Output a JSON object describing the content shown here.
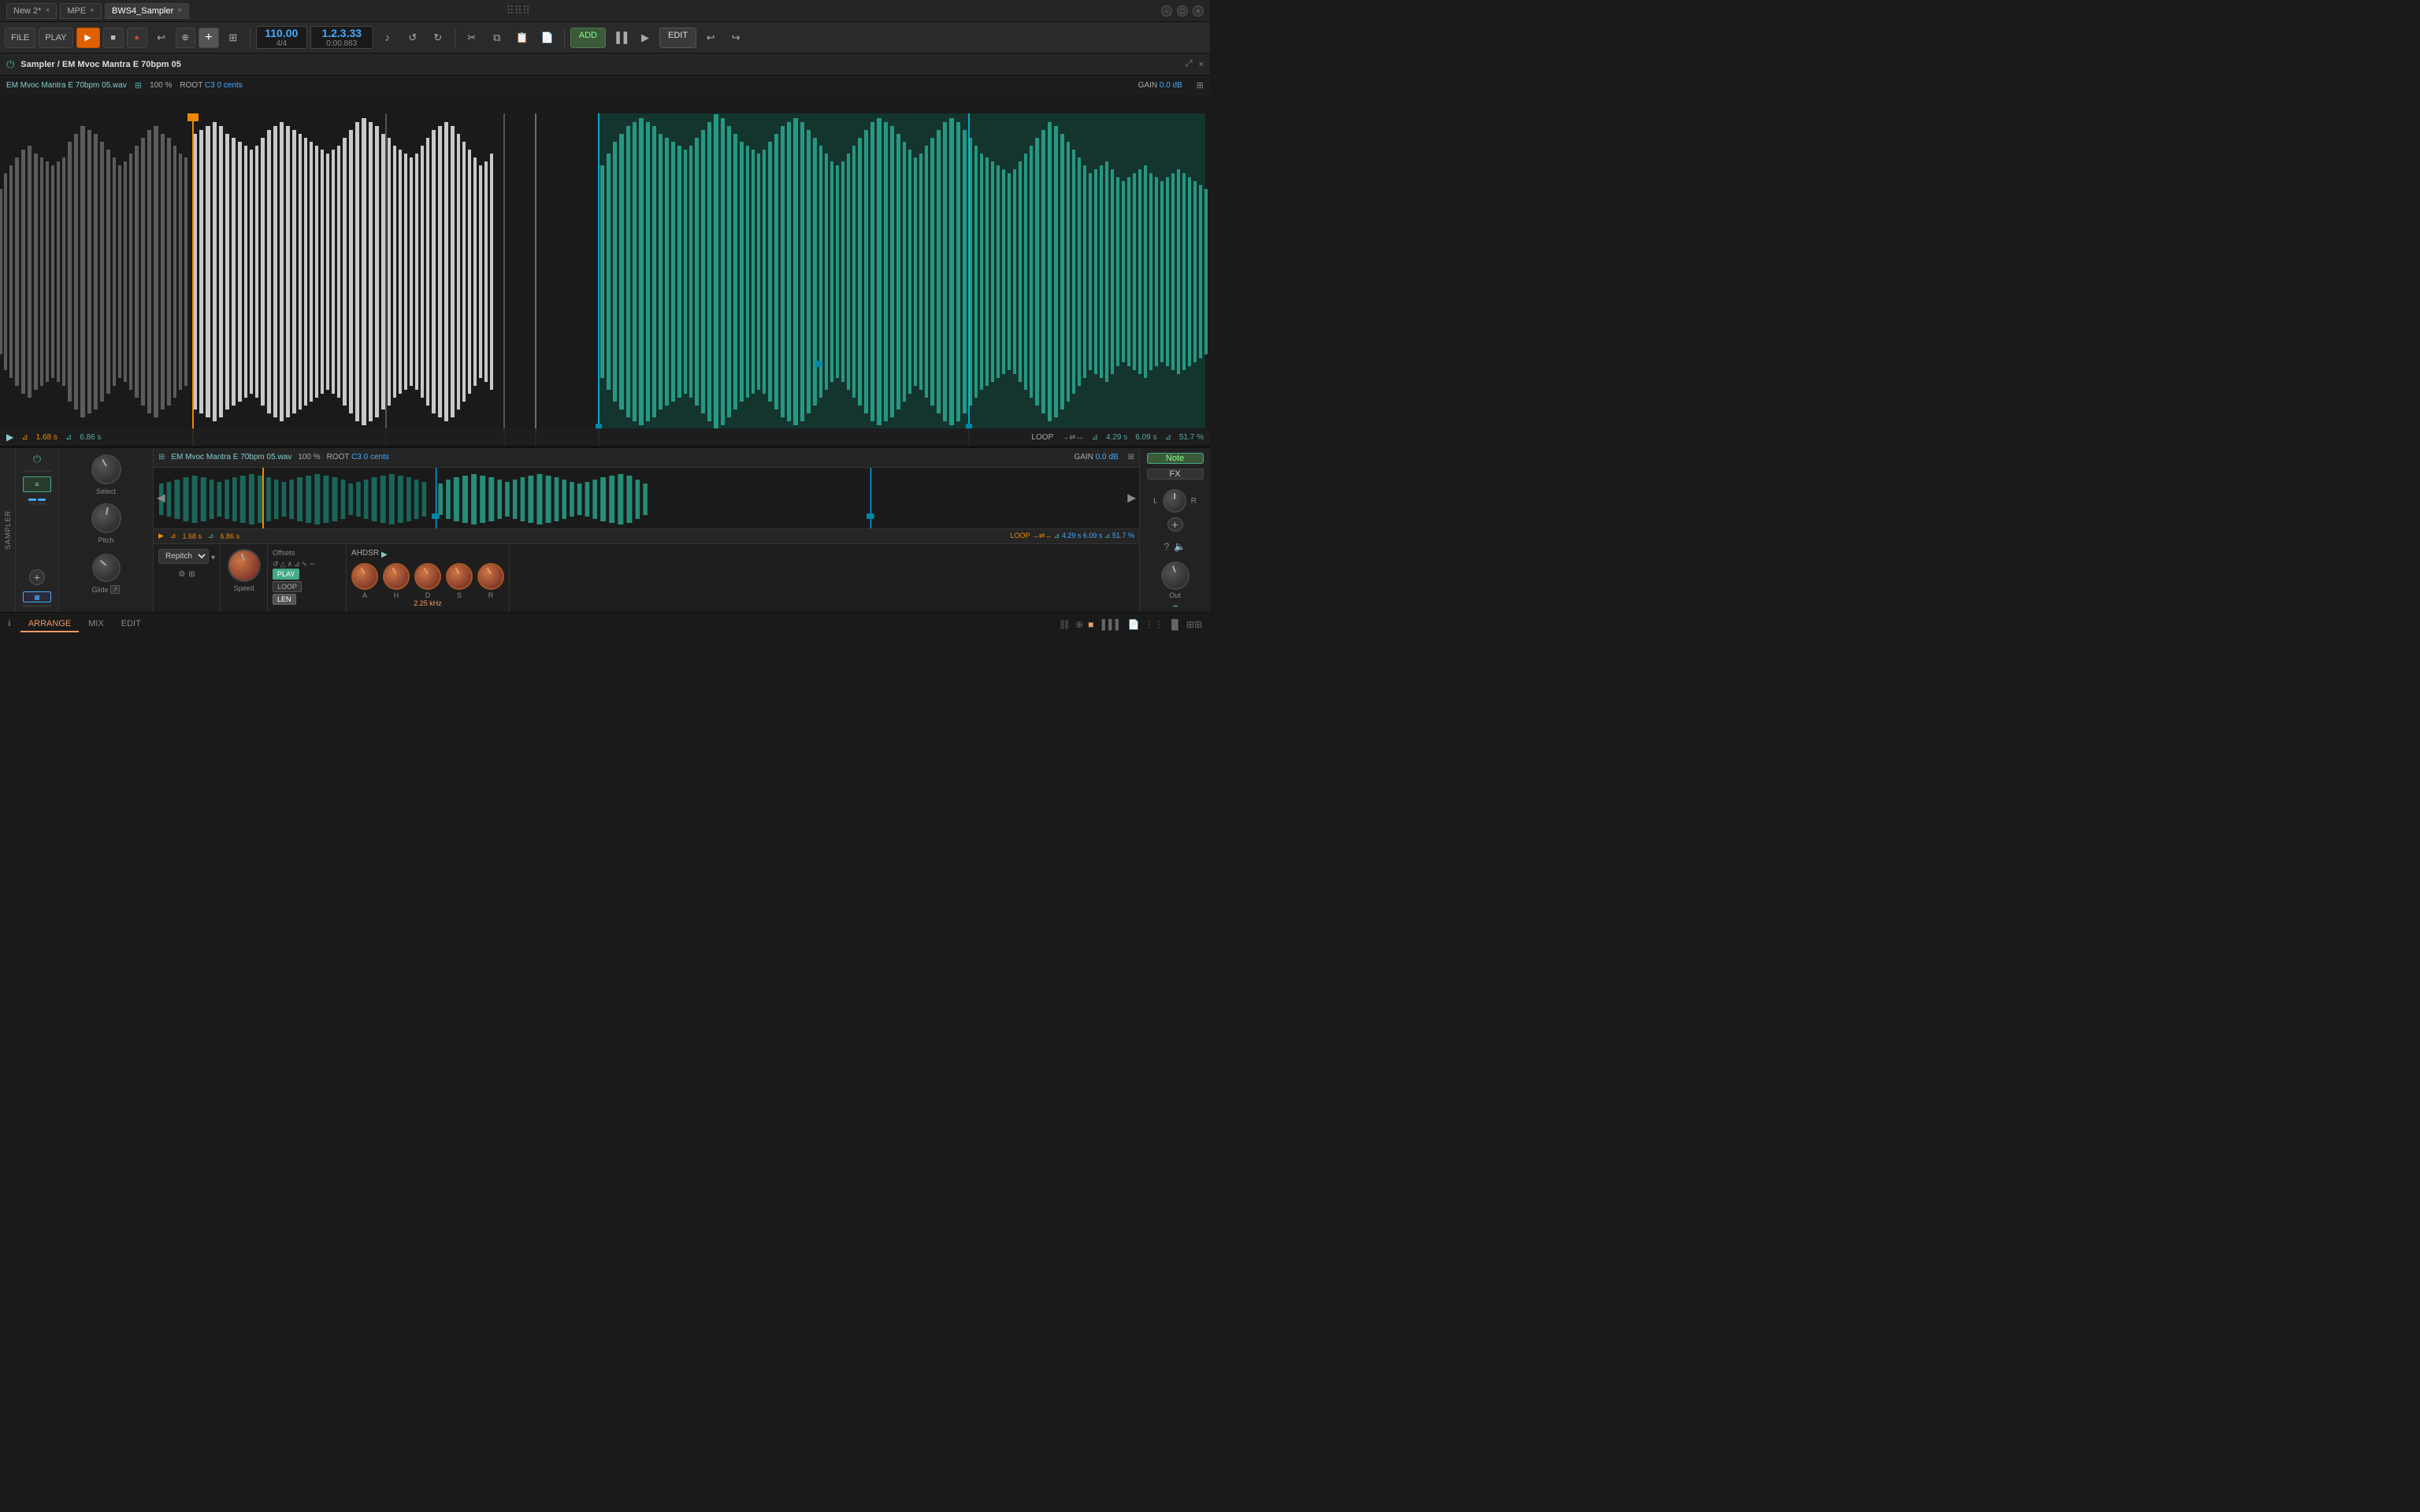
{
  "tabs": [
    {
      "label": "New 2*",
      "active": false,
      "closable": true
    },
    {
      "label": "MPE",
      "active": false,
      "closable": true
    },
    {
      "label": "BWS4_Sampler",
      "active": true,
      "closable": true
    }
  ],
  "toolbar": {
    "file_label": "FILE",
    "play_label": "PLAY",
    "add_label": "+",
    "edit_label": "EDIT",
    "add_track_label": "ADD",
    "tempo": "110.00",
    "time_sig": "4/4",
    "position": "1.2.3.33",
    "time": "0:00.863"
  },
  "sampler": {
    "title": "Sampler / EM Mvoc Mantra E 70bpm 05",
    "filename": "EM Mvoc Mantra E 70bpm 05.wav",
    "zoom": "100 %",
    "root_note": "C3",
    "root_cents": "0 cents",
    "gain": "0.0 dB",
    "play_pos": "1.68 s",
    "length": "6.86 s",
    "loop_start": "4.29 s",
    "loop_end": "6.09 s",
    "loop_pct": "51.7 %"
  },
  "bottom": {
    "note_label": "Note",
    "fx_label": "FX",
    "out_label": "Out",
    "repitch_label": "Repitch",
    "speed_label": "Speed",
    "offsets_label": "Offsets",
    "play_label": "PLAY",
    "loop_label": "LOOP",
    "len_label": "LEN",
    "ahdsr_label": "AHDSR",
    "freq_label": "2.25 kHz",
    "env_labels": [
      "A",
      "H",
      "D",
      "S",
      "R"
    ],
    "pitch_label": "Pitch",
    "select_label": "Select",
    "glide_label": "Glide"
  },
  "nav": {
    "tabs": [
      "ARRANGE",
      "MIX",
      "EDIT"
    ],
    "active": "ARRANGE"
  }
}
